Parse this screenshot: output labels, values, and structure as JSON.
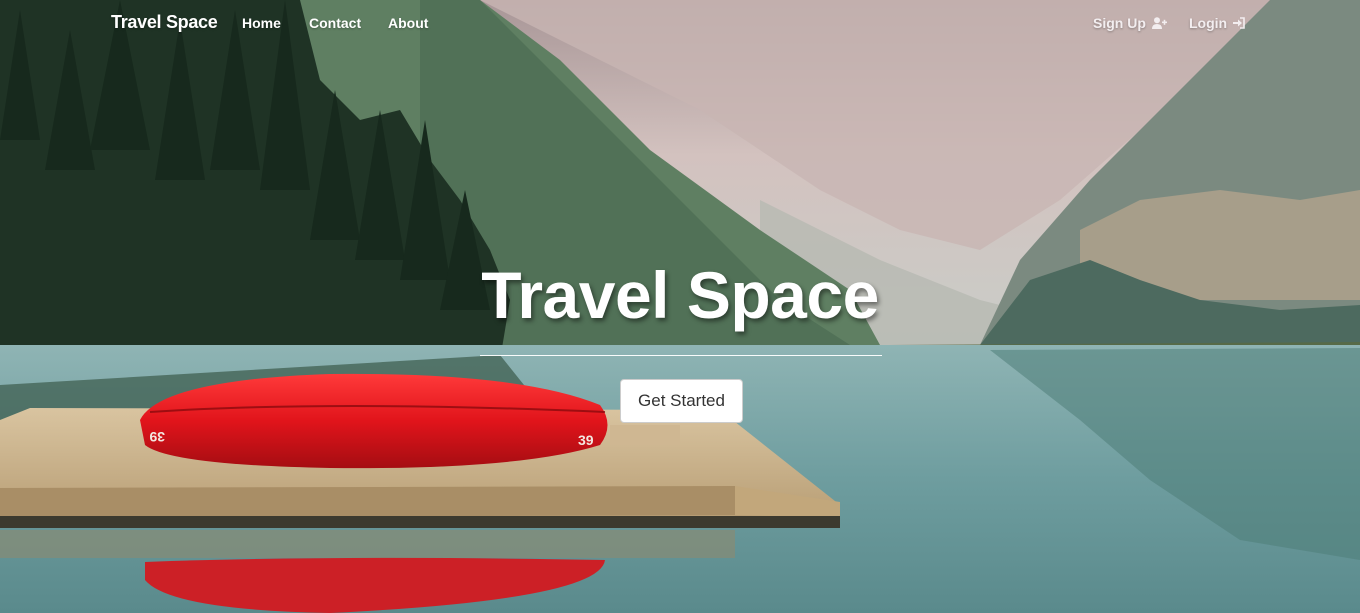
{
  "navbar": {
    "brand": "Travel Space",
    "links": [
      {
        "label": "Home"
      },
      {
        "label": "Contact"
      },
      {
        "label": "About"
      }
    ],
    "right_links": [
      {
        "label": "Sign Up",
        "icon": "user-plus-icon"
      },
      {
        "label": "Login",
        "icon": "sign-in-icon"
      }
    ]
  },
  "hero": {
    "title": "Travel Space",
    "cta_label": "Get Started",
    "background": "lake-with-red-canoe-on-dock"
  },
  "colors": {
    "nav_text": "#ffffff",
    "button_bg": "#ffffff",
    "button_text": "#333333",
    "canoe_red": "#e0141b",
    "lake_teal": "#6f9c9e"
  }
}
